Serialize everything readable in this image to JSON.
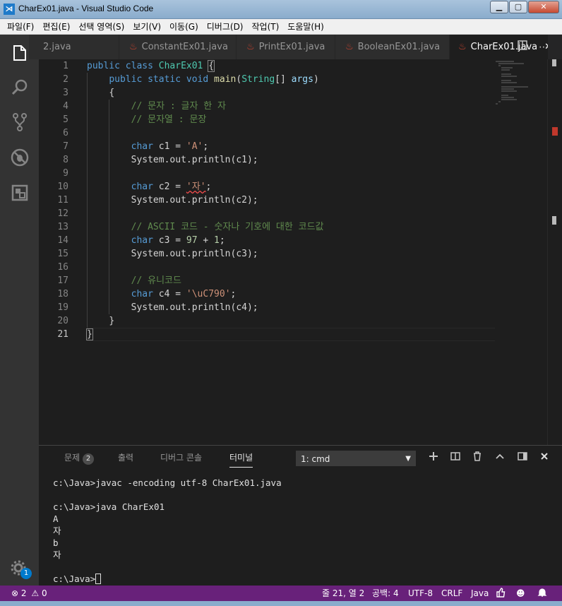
{
  "window": {
    "title": "CharEx01.java - Visual Studio Code",
    "app_icon": "vscode-icon",
    "buttons": [
      "minimize",
      "maximize",
      "close"
    ]
  },
  "menu": [
    "파일(F)",
    "편집(E)",
    "선택 영역(S)",
    "보기(V)",
    "이동(G)",
    "디버그(D)",
    "작업(T)",
    "도움말(H)"
  ],
  "activity_bar": {
    "icons": [
      "files-icon",
      "search-icon",
      "source-control-icon",
      "debug-icon",
      "extensions-icon"
    ],
    "settings_badge": "1"
  },
  "tabs": [
    {
      "label": "2.java",
      "active": false
    },
    {
      "label": "ConstantEx01.java",
      "active": false
    },
    {
      "label": "PrintEx01.java",
      "active": false
    },
    {
      "label": "BooleanEx01.java",
      "active": false
    },
    {
      "label": "CharEx01.java",
      "active": true
    }
  ],
  "tab_close": "✕",
  "editor": {
    "line_numbers": [
      "1",
      "2",
      "3",
      "4",
      "5",
      "6",
      "7",
      "8",
      "9",
      "10",
      "11",
      "12",
      "13",
      "14",
      "15",
      "16",
      "17",
      "18",
      "19",
      "20",
      "21"
    ],
    "current_line": "21",
    "code": {
      "l1": {
        "kw1": "public",
        "kw2": "class",
        "name": "CharEx01",
        "brace": "{"
      },
      "l2": {
        "kw1": "public",
        "kw2": "static",
        "kw3": "void",
        "fn": "main",
        "type": "String",
        "rest": "[] ",
        "param": "args",
        "close": ")"
      },
      "l3": {
        "text": "{"
      },
      "l4": {
        "comment": "// 문자 : 글자 한 자"
      },
      "l5": {
        "comment": "// 문자열 : 문장"
      },
      "l7": {
        "kw": "char",
        "rest": " c1 = ",
        "str": "'A'",
        "end": ";"
      },
      "l8": {
        "text": "System.out.println(c1);"
      },
      "l10": {
        "kw": "char",
        "rest": " c2 = ",
        "str": "'자'",
        "end": ";"
      },
      "l11": {
        "text": "System.out.println(c2);"
      },
      "l13": {
        "comment": "// ASCII 코드 - 숫자나 기호에 대한 코드값"
      },
      "l14": {
        "kw": "char",
        "rest": " c3 = ",
        "num1": "97",
        "op": " + ",
        "num2": "1",
        "end": ";"
      },
      "l15": {
        "text": "System.out.println(c3);"
      },
      "l17": {
        "comment": "// 유니코드"
      },
      "l18": {
        "kw": "char",
        "rest": " c4 = ",
        "str": "'\\uC790'",
        "end": ";"
      },
      "l19": {
        "text": "System.out.println(c4);"
      },
      "l20": {
        "text": "}"
      },
      "l21": {
        "text": "}"
      }
    }
  },
  "panel": {
    "tabs": [
      {
        "label": "문제",
        "badge": "2"
      },
      {
        "label": "출력"
      },
      {
        "label": "디버그 콘솔"
      },
      {
        "label": "터미널",
        "active": true
      }
    ],
    "terminal_select": "1: cmd",
    "actions": [
      "plus-icon",
      "split-icon",
      "trash-icon",
      "chevron-up-icon",
      "maximize-icon",
      "close-icon"
    ],
    "terminal_lines": [
      "c:\\Java>javac -encoding utf-8 CharEx01.java",
      "",
      "c:\\Java>java CharEx01",
      "A",
      "자",
      "b",
      "자",
      "",
      "c:\\Java>"
    ]
  },
  "status_bar": {
    "errors": "2",
    "warnings": "0",
    "position": "줄 21, 열 2",
    "spaces": "공백: 4",
    "encoding": "UTF-8",
    "eol": "CRLF",
    "language": "Java"
  },
  "colors": {
    "status_bar": "#68217a",
    "activity_bar": "#333333",
    "editor_bg": "#1e1e1e",
    "java_icon": "#c7432f"
  }
}
